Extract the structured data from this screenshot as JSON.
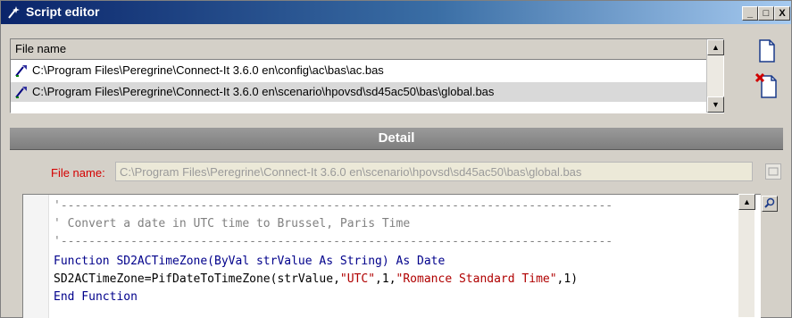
{
  "window": {
    "title": "Script editor",
    "minimize_glyph": "_",
    "restore_glyph": "□",
    "close_glyph": "X"
  },
  "filelist": {
    "header": "File name",
    "rows": [
      {
        "path": "C:\\Program Files\\Peregrine\\Connect-It 3.6.0 en\\config\\ac\\bas\\ac.bas",
        "selected": false
      },
      {
        "path": "C:\\Program Files\\Peregrine\\Connect-It 3.6.0 en\\scenario\\hpovsd\\sd45ac50\\bas\\global.bas",
        "selected": true
      }
    ],
    "scroll_up_glyph": "▲",
    "scroll_down_glyph": "▼"
  },
  "side_buttons": {
    "new_icon": "new-document-icon",
    "delete_icon": "delete-document-icon"
  },
  "detail": {
    "header": "Detail",
    "file_name_label": "File name:",
    "file_name_value": "C:\\Program Files\\Peregrine\\Connect-It 3.6.0 en\\scenario\\hpovsd\\sd45ac50\\bas\\global.bas"
  },
  "code": {
    "lines": [
      {
        "parts": [
          {
            "t": "'-------------------------------------------------------------------------------",
            "c": "cmt"
          }
        ]
      },
      {
        "parts": [
          {
            "t": "' Convert a date in UTC time to Brussel, Paris Time",
            "c": "cmt"
          }
        ]
      },
      {
        "parts": [
          {
            "t": "'-------------------------------------------------------------------------------",
            "c": "cmt"
          }
        ]
      },
      {
        "parts": [
          {
            "t": "Function SD2ACTimeZone(ByVal strValue As String) As Date",
            "c": "kw"
          }
        ]
      },
      {
        "parts": [
          {
            "t": "SD2ACTimeZone=PifDateToTimeZone(strValue,",
            "c": "txt-plain"
          },
          {
            "t": "\"UTC\"",
            "c": "str"
          },
          {
            "t": ",1,",
            "c": "txt-plain"
          },
          {
            "t": "\"Romance Standard Time\"",
            "c": "str"
          },
          {
            "t": ",1)",
            "c": "txt-plain"
          }
        ]
      },
      {
        "parts": [
          {
            "t": "End Function",
            "c": "kw"
          }
        ]
      }
    ],
    "scroll_up_glyph": "▲"
  }
}
